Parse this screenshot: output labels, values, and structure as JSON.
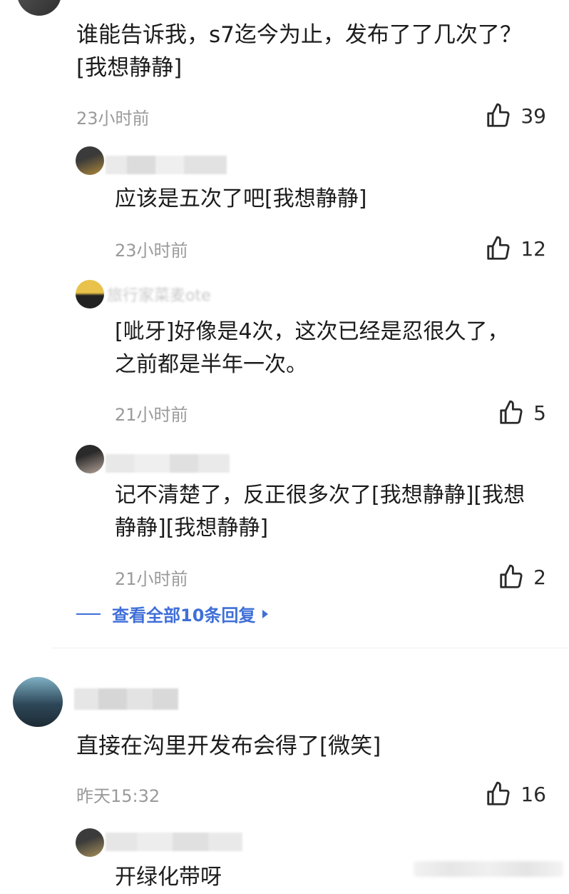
{
  "comment1": {
    "text": "谁能告诉我，s7迄今为止，发布了了几次了？[我想静静]",
    "time": "23小时前",
    "likes": "39"
  },
  "replies": [
    {
      "text": "应该是五次了吧[我想静静]",
      "time": "23小时前",
      "likes": "12",
      "name_fragment": ""
    },
    {
      "text": "[呲牙]好像是4次，这次已经是忍很久了，之前都是半年一次。",
      "time": "21小时前",
      "likes": "5",
      "name_fragment": "旅行家菜麦ote"
    },
    {
      "text": "记不清楚了，反正很多次了[我想静静][我想静静][我想静静]",
      "time": "21小时前",
      "likes": "2",
      "name_fragment": ""
    }
  ],
  "view_all": {
    "label": "查看全部10条回复"
  },
  "comment2": {
    "text": "直接在沟里开发布会得了[微笑]",
    "time": "昨天15:32",
    "likes": "16"
  },
  "reply_partial": {
    "text": "开绿化带呀"
  },
  "colors": {
    "link": "#3f6fd8",
    "time": "#9a9a9a"
  }
}
